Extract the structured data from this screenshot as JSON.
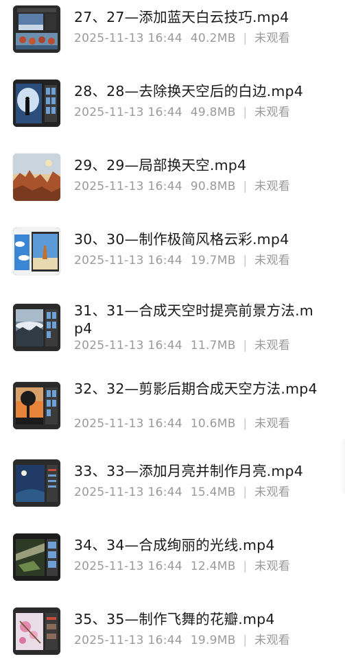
{
  "files": [
    {
      "title": "27、27—添加蓝天白云技巧.mp4",
      "date": "2025-11-13 16:44",
      "size": "40.2MB",
      "status": "未观看",
      "thumb_icon": "video-thumbnail-icon"
    },
    {
      "title": "28、28—去除换天空后的白边.mp4",
      "date": "2025-11-13 16:44",
      "size": "49.8MB",
      "status": "未观看",
      "thumb_icon": "video-thumbnail-icon"
    },
    {
      "title": "29、29—局部换天空.mp4",
      "date": "2025-11-13 16:44",
      "size": "90.8MB",
      "status": "未观看",
      "thumb_icon": "video-thumbnail-icon"
    },
    {
      "title": "30、30—制作极简风格云彩.mp4",
      "date": "2025-11-13 16:44",
      "size": "19.7MB",
      "status": "未观看",
      "thumb_icon": "video-thumbnail-icon"
    },
    {
      "title": "31、31—合成天空时提亮前景方法.mp4",
      "date": "2025-11-13 16:44",
      "size": "11.7MB",
      "status": "未观看",
      "thumb_icon": "video-thumbnail-icon"
    },
    {
      "title": "32、32—剪影后期合成天空方法.mp4",
      "date": "2025-11-13 16:44",
      "size": "10.6MB",
      "status": "未观看",
      "thumb_icon": "video-thumbnail-icon"
    },
    {
      "title": "33、33—添加月亮并制作月亮.mp4",
      "date": "2025-11-13 16:44",
      "size": "15.4MB",
      "status": "未观看",
      "thumb_icon": "video-thumbnail-icon"
    },
    {
      "title": "34、34—合成绚丽的光线.mp4",
      "date": "2025-11-13 16:44",
      "size": "12.4MB",
      "status": "未观看",
      "thumb_icon": "video-thumbnail-icon"
    },
    {
      "title": "35、35—制作飞舞的花瓣.mp4",
      "date": "2025-11-13 16:44",
      "size": "19.9MB",
      "status": "未观看",
      "thumb_icon": "video-thumbnail-icon"
    }
  ],
  "colors": {
    "title": "#1a1a1a",
    "meta": "#9a9a9a",
    "separator": "#c8c8c8"
  }
}
